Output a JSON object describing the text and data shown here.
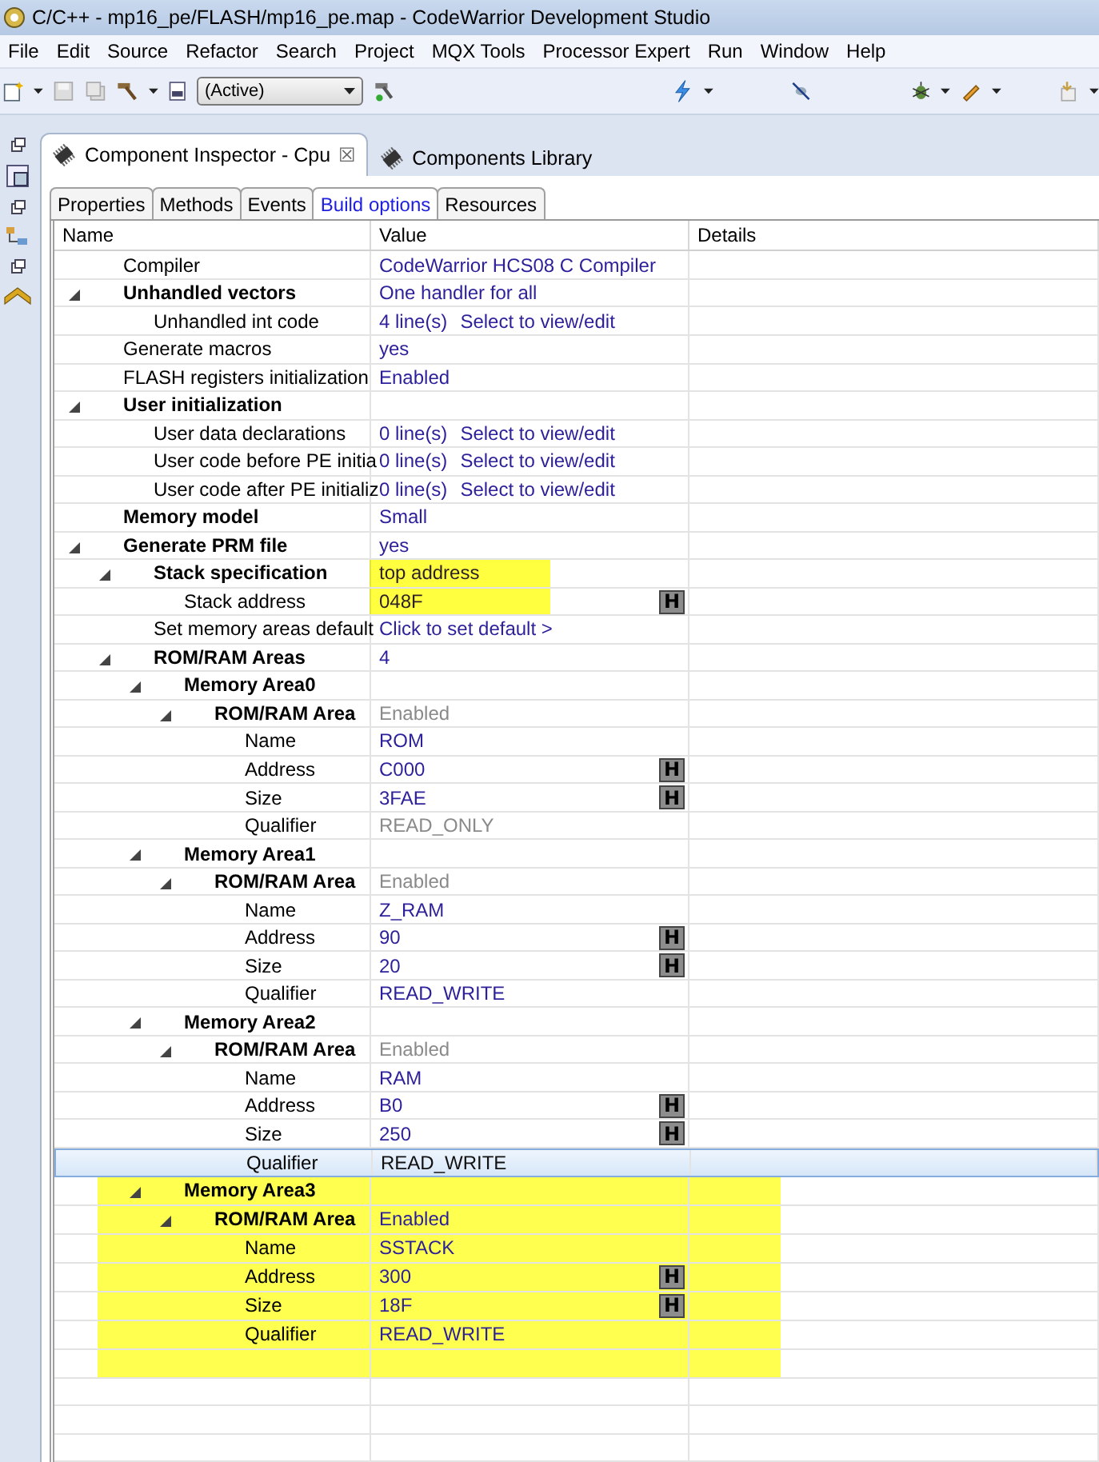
{
  "window": {
    "title": "C/C++ - mp16_pe/FLASH/mp16_pe.map - CodeWarrior Development Studio"
  },
  "menu": [
    "File",
    "Edit",
    "Source",
    "Refactor",
    "Search",
    "Project",
    "MQX Tools",
    "Processor Expert",
    "Run",
    "Window",
    "Help"
  ],
  "toolbar": {
    "configuration": "(Active)"
  },
  "views": [
    {
      "label": "Component Inspector - Cpu",
      "selected": true,
      "close": "☒"
    },
    {
      "label": "Components Library",
      "selected": false
    }
  ],
  "inspector_tabs": [
    {
      "label": "Properties",
      "selected": false
    },
    {
      "label": "Methods",
      "selected": false
    },
    {
      "label": "Events",
      "selected": false
    },
    {
      "label": "Build options",
      "selected": true
    },
    {
      "label": "Resources",
      "selected": false
    }
  ],
  "table": {
    "columns": [
      "Name",
      "Value",
      "Details"
    ],
    "rows": [
      {
        "name": "Compiler",
        "value": "CodeWarrior HCS08 C Compiler",
        "bold": false,
        "selected": false
      },
      {
        "name": "Unhandled vectors",
        "value": "One handler for all",
        "bold": true,
        "selected": false,
        "expanded": true,
        "children": [
          {
            "name": "Unhandled int code",
            "value": "4 line(s)",
            "action": "Select to view/edit",
            "bold": false,
            "selected": false
          }
        ]
      },
      {
        "name": "Generate macros",
        "value": "yes",
        "bold": false,
        "selected": false
      },
      {
        "name": "FLASH registers initialization",
        "value": "Enabled",
        "bold": false,
        "selected": false
      },
      {
        "name": "User initialization",
        "bold": true,
        "selected": false,
        "expanded": true,
        "children": [
          {
            "name": "User data declarations",
            "value": "0 line(s)",
            "action": "Select to view/edit",
            "bold": false,
            "selected": false
          },
          {
            "name": "User code before PE initia",
            "value": "0 line(s)",
            "action": "Select to view/edit",
            "bold": false,
            "selected": false
          },
          {
            "name": "User code after PE initializ",
            "value": "0 line(s)",
            "action": "Select to view/edit",
            "bold": false,
            "selected": false
          }
        ]
      },
      {
        "name": "Memory model",
        "value": "Small",
        "bold": true,
        "selected": false
      },
      {
        "name": "Generate PRM file",
        "value": "yes",
        "bold": true,
        "selected": false,
        "expanded": true,
        "children": [
          {
            "name": "Stack specification",
            "value": "top address",
            "bold": true,
            "selected": false,
            "highlighted": true,
            "expanded": true,
            "children": [
              {
                "name": "Stack address",
                "value": "048F",
                "bold": false,
                "selected": false,
                "highlighted": true,
                "hex": "H"
              }
            ]
          },
          {
            "name": "Set memory areas default",
            "value": "Click to set default >",
            "bold": false,
            "selected": false
          },
          {
            "name": "ROM/RAM Areas",
            "value": "4",
            "bold": true,
            "selected": false,
            "expanded": true,
            "children": [
              {
                "name": "Memory Area0",
                "bold": true,
                "selected": false,
                "expanded": true,
                "children": [
                  {
                    "name": "ROM/RAM Area",
                    "value": "Enabled",
                    "bold": true,
                    "disabled": true,
                    "selected": false,
                    "expanded": true,
                    "children": [
                      {
                        "name": "Name",
                        "value": "ROM",
                        "bold": false,
                        "selected": false
                      },
                      {
                        "name": "Address",
                        "value": "C000",
                        "bold": false,
                        "selected": false,
                        "hex": "H"
                      },
                      {
                        "name": "Size",
                        "value": "3FAE",
                        "bold": false,
                        "selected": false,
                        "hex": "H"
                      },
                      {
                        "name": "Qualifier",
                        "value": "READ_ONLY",
                        "bold": false,
                        "disabled": true,
                        "selected": false
                      }
                    ]
                  }
                ]
              },
              {
                "name": "Memory Area1",
                "bold": true,
                "selected": false,
                "expanded": true,
                "children": [
                  {
                    "name": "ROM/RAM Area",
                    "value": "Enabled",
                    "bold": true,
                    "disabled": true,
                    "selected": false,
                    "expanded": true,
                    "children": [
                      {
                        "name": "Name",
                        "value": "Z_RAM",
                        "bold": false,
                        "selected": false
                      },
                      {
                        "name": "Address",
                        "value": "90",
                        "bold": false,
                        "selected": false,
                        "hex": "H"
                      },
                      {
                        "name": "Size",
                        "value": "20",
                        "bold": false,
                        "selected": false,
                        "hex": "H"
                      },
                      {
                        "name": "Qualifier",
                        "value": "READ_WRITE",
                        "bold": false,
                        "selected": false
                      }
                    ]
                  }
                ]
              },
              {
                "name": "Memory Area2",
                "bold": true,
                "selected": false,
                "expanded": true,
                "children": [
                  {
                    "name": "ROM/RAM Area",
                    "value": "Enabled",
                    "bold": true,
                    "disabled": true,
                    "selected": false,
                    "expanded": true,
                    "children": [
                      {
                        "name": "Name",
                        "value": "RAM",
                        "bold": false,
                        "selected": false
                      },
                      {
                        "name": "Address",
                        "value": "B0",
                        "bold": false,
                        "selected": false,
                        "hex": "H"
                      },
                      {
                        "name": "Size",
                        "value": "250",
                        "bold": false,
                        "selected": false,
                        "hex": "H"
                      },
                      {
                        "name": "Qualifier",
                        "value": "READ_WRITE",
                        "bold": false,
                        "selected": true
                      }
                    ]
                  }
                ]
              },
              {
                "name": "Memory Area3",
                "bold": true,
                "selected": false,
                "group_highlighted": true,
                "expanded": true,
                "children": [
                  {
                    "name": "ROM/RAM Area",
                    "value": "Enabled",
                    "bold": true,
                    "selected": false,
                    "expanded": true,
                    "children": [
                      {
                        "name": "Name",
                        "value": "SSTACK",
                        "bold": false,
                        "selected": false
                      },
                      {
                        "name": "Address",
                        "value": "300",
                        "bold": false,
                        "selected": false,
                        "hex": "H"
                      },
                      {
                        "name": "Size",
                        "value": "18F",
                        "bold": false,
                        "selected": false,
                        "hex": "H"
                      },
                      {
                        "name": "Qualifier",
                        "value": "READ_WRITE",
                        "bold": false,
                        "selected": false
                      }
                    ]
                  }
                ]
              }
            ]
          }
        ]
      }
    ]
  }
}
